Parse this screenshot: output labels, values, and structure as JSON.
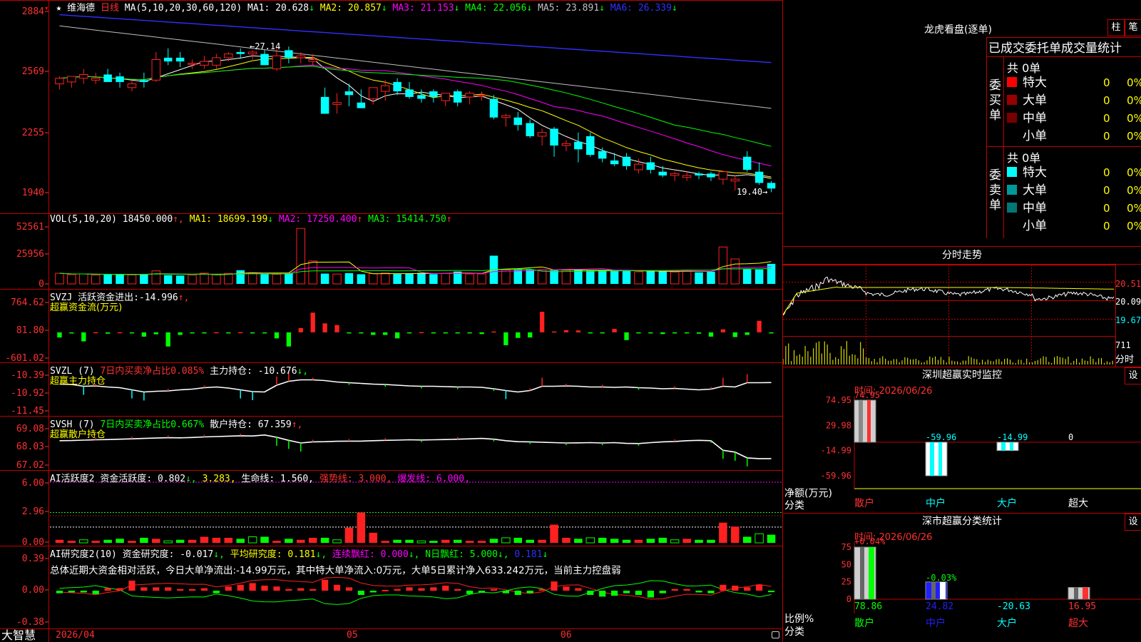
{
  "colors": {
    "up": "#ff2020",
    "down": "#00ffff",
    "ma1": "#ffffff",
    "ma2": "#ffff00",
    "ma3": "#ff00ff",
    "ma4": "#00ff00",
    "ma5": "#c0c0c0",
    "ma6": "#3030ff",
    "grid": "#c00000",
    "green": "#00ff00",
    "magenta": "#ff00ff",
    "yellow": "#ffff00",
    "cyan": "#00ffff"
  },
  "stock": {
    "name": "维海德",
    "period": "日线",
    "star": "★"
  },
  "main_panel": {
    "ma_label": "MA(5,10,20,30,60,120)",
    "ma": [
      {
        "label": "MA1:",
        "value": "20.628",
        "arrow": "↓"
      },
      {
        "label": "MA2:",
        "value": "20.857",
        "arrow": "↓"
      },
      {
        "label": "MA3:",
        "value": "21.153",
        "arrow": "↓"
      },
      {
        "label": "MA4:",
        "value": "22.056",
        "arrow": "↓"
      },
      {
        "label": "MA5:",
        "value": "23.891",
        "arrow": "↓"
      },
      {
        "label": "MA6:",
        "value": "26.339",
        "arrow": "↓"
      }
    ],
    "y_ticks": [
      "2884",
      "2569",
      "2255",
      "1940"
    ],
    "high_note": "27.14",
    "low_note": "19.40→"
  },
  "vol_panel": {
    "label": "VOL(5,10,20)",
    "value": "18450.000",
    "arrow": "↑",
    "ma": [
      {
        "label": "MA1:",
        "value": "18699.199",
        "arrow": "↓"
      },
      {
        "label": "MA2:",
        "value": "17250.400",
        "arrow": "↑"
      },
      {
        "label": "MA3:",
        "value": "15414.750",
        "arrow": "↑"
      }
    ],
    "y_ticks": [
      "52561",
      "25956",
      "0"
    ]
  },
  "svzj_panel": {
    "label": "SVZJ",
    "text": "活跃资金进出:",
    "value": "-14.996",
    "arrow": "↑",
    "subtitle": "超赢资金流(万元)",
    "y_ticks": [
      "764.62",
      "81.80",
      "-601.02"
    ]
  },
  "svzl_panel": {
    "label": "SVZL (7)",
    "note": "7日内买卖净占比0.085%",
    "text": "主力持仓:",
    "value": "-10.676",
    "arrow": "↓,",
    "subtitle": "超赢主力持仓",
    "y_ticks": [
      "-10.39",
      "-10.92",
      "-11.45"
    ]
  },
  "svsh_panel": {
    "label": "SVSH (7)",
    "note": "7日内买卖净占比0.667%",
    "text": "散户持仓:",
    "value": "67.359",
    "arrow": "↑,",
    "subtitle": "超赢散户持仓",
    "y_ticks": [
      "69.08",
      "68.03",
      "67.02"
    ]
  },
  "ai1_panel": {
    "label": "AI活跃度2",
    "t1": "资金活跃度:",
    "v1": "0.802",
    "a1": "↓,",
    "v2": "3.283,",
    "t3": "生命线:",
    "v3": "1.560,",
    "t4": "强势线:",
    "v4": "3.000,",
    "t5": "爆发线:",
    "v5": "6.000,",
    "y_ticks": [
      "6.00",
      "2.96",
      "0.00"
    ]
  },
  "ai2_panel": {
    "label": "AI研究度2(10)",
    "t1": "资金研究度:",
    "v1": "-0.017",
    "a1": "↓,",
    "t2": "平均研究度:",
    "v2": "0.181",
    "a2": "↓,",
    "t3": "连续飘红:",
    "v3": "0.000",
    "a3": "↓,",
    "t4": "N日飘红:",
    "v4": "5.000",
    "a4": "↓,",
    "v5": "0.181",
    "a5": "↓",
    "summary": "总体近期大资金相对活跃，今日大单净流出:-14.99万元，其中特大单净流入:0万元，大单5日累计净入633.242万元，当前主力控盘弱",
    "y_ticks": [
      "0.39",
      "0.00",
      "-0.38"
    ]
  },
  "bottom": {
    "brand": "大智慧",
    "dates": [
      "2026/04",
      "05",
      "06"
    ]
  },
  "lhb": {
    "title": "龙虎看盘(逐单)",
    "btn_zhu": "柱",
    "btn_bi": "笔",
    "heading": "已成交委托单成交量统计",
    "buy": {
      "side": "委买单",
      "total": "共 0单",
      "rows": [
        {
          "name": "特大",
          "count": "0",
          "pct": "0%",
          "color": "#ff0000"
        },
        {
          "name": "大单",
          "count": "0",
          "pct": "0%",
          "color": "#990000"
        },
        {
          "name": "中单",
          "count": "0",
          "pct": "0%",
          "color": "#770000"
        },
        {
          "name": "小单",
          "count": "0",
          "pct": "0%",
          "color": "#000000"
        }
      ]
    },
    "sell": {
      "side": "委卖单",
      "total": "共 0单",
      "rows": [
        {
          "name": "特大",
          "count": "0",
          "pct": "0%",
          "color": "#00ffff"
        },
        {
          "name": "大单",
          "count": "0",
          "pct": "0%",
          "color": "#009999"
        },
        {
          "name": "中单",
          "count": "0",
          "pct": "0%",
          "color": "#007777"
        },
        {
          "name": "小单",
          "count": "0",
          "pct": "0%",
          "color": "#000000"
        }
      ]
    }
  },
  "intraday": {
    "title": "分时走势",
    "prices": [
      "20.51",
      "20.09",
      "19.67"
    ],
    "vol": "711",
    "vol_label": "分时"
  },
  "sz_monitor": {
    "title": "深圳超赢实时监控",
    "btn": "设",
    "date": "时间: 2026/06/26",
    "y_ticks": [
      "74.95",
      "29.98",
      "-14.99",
      "-59.96"
    ],
    "axis_label": "净额(万元)",
    "axis_label2": "分类",
    "bars": [
      {
        "name": "散户",
        "value": 74.95,
        "label": "74.95"
      },
      {
        "name": "中户",
        "value": -59.96,
        "label": "-59.96"
      },
      {
        "name": "大户",
        "value": -14.99,
        "label": "-14.99"
      },
      {
        "name": "超大",
        "value": 0,
        "label": "0"
      }
    ]
  },
  "sz_class": {
    "title": "深市超赢分类统计",
    "btn": "设",
    "date": "时间: 2026/06/26",
    "y_ticks": [
      "75",
      "50",
      "25",
      "0"
    ],
    "axis_label": "比例%",
    "axis_label2": "分类",
    "top_labels": [
      "+0.04%",
      "-0.03%"
    ],
    "bars": [
      {
        "name": "散户",
        "value": 78.86,
        "label": "78.86"
      },
      {
        "name": "中户",
        "value": 24.82,
        "label": "24.82"
      },
      {
        "name": "大户",
        "value": -20.63,
        "label": "-20.63"
      },
      {
        "name": "超大",
        "value": 16.95,
        "label": "16.95"
      }
    ]
  },
  "chart_data": [
    {
      "type": "candlestick",
      "title": "维海德 日线",
      "ylim": [
        19.0,
        29.0
      ],
      "x": [
        "04-01",
        "04-02",
        "04-03",
        "04-06",
        "04-07",
        "04-08",
        "04-09",
        "04-10",
        "04-13",
        "04-14",
        "04-15",
        "04-16",
        "04-17",
        "04-20",
        "04-21",
        "04-22",
        "04-23",
        "04-24",
        "04-27",
        "04-28",
        "04-29",
        "04-30",
        "05-06",
        "05-07",
        "05-08",
        "05-11",
        "05-12",
        "05-13",
        "05-14",
        "05-15",
        "05-18",
        "05-19",
        "05-20",
        "05-21",
        "05-22",
        "05-25",
        "05-26",
        "05-27",
        "05-28",
        "05-29",
        "06-01",
        "06-02",
        "06-03",
        "06-04",
        "06-05",
        "06-08",
        "06-09",
        "06-10",
        "06-11",
        "06-12",
        "06-15",
        "06-16",
        "06-17",
        "06-18",
        "06-19",
        "06-22",
        "06-23",
        "06-24",
        "06-25",
        "06-26"
      ],
      "open": [
        25.2,
        25.3,
        25.5,
        25.4,
        25.7,
        25.6,
        25.0,
        25.4,
        25.4,
        26.6,
        26.6,
        26.3,
        26.2,
        26.2,
        26.6,
        26.9,
        26.8,
        26.8,
        26.0,
        27.0,
        26.6,
        26.4,
        24.5,
        24.1,
        24.8,
        24.2,
        24.4,
        24.8,
        25.3,
        24.9,
        24.6,
        24.8,
        24.3,
        24.8,
        24.5,
        24.6,
        24.4,
        23.4,
        23.4,
        23.1,
        22.4,
        22.8,
        21.9,
        22.1,
        22.4,
        21.6,
        21.1,
        21.3,
        20.6,
        21.0,
        20.5,
        20.3,
        20.2,
        20.4,
        20.4,
        20.1,
        20.0,
        21.3,
        20.5,
        19.9
      ],
      "high": [
        25.6,
        25.6,
        26.0,
        25.8,
        26.0,
        25.8,
        25.4,
        25.8,
        26.9,
        27.1,
        26.9,
        26.5,
        26.7,
        26.8,
        26.9,
        27.1,
        27.0,
        27.0,
        27.14,
        27.2,
        26.9,
        26.8,
        25.0,
        24.7,
        25.2,
        24.9,
        25.0,
        25.4,
        25.5,
        25.3,
        24.9,
        24.9,
        24.7,
        24.9,
        24.8,
        24.8,
        24.6,
        23.6,
        23.7,
        23.3,
        22.8,
        22.9,
        22.2,
        22.6,
        22.6,
        21.8,
        21.5,
        21.5,
        21.2,
        21.3,
        20.8,
        20.5,
        20.5,
        20.5,
        20.5,
        20.5,
        20.3,
        21.6,
        21.0,
        20.0
      ],
      "low": [
        24.9,
        25.0,
        25.2,
        25.2,
        25.4,
        25.0,
        24.8,
        25.0,
        25.3,
        26.2,
        26.1,
        26.0,
        26.0,
        26.0,
        26.4,
        26.6,
        26.5,
        26.3,
        25.9,
        26.3,
        26.3,
        26.2,
        23.6,
        23.6,
        24.0,
        23.9,
        24.1,
        24.3,
        24.6,
        24.4,
        24.2,
        24.2,
        24.0,
        24.0,
        24.1,
        24.3,
        23.3,
        22.9,
        22.7,
        22.3,
        21.9,
        21.3,
        21.6,
        21.0,
        21.3,
        21.0,
        20.8,
        20.6,
        20.4,
        20.4,
        20.2,
        20.0,
        20.0,
        20.1,
        20.0,
        19.8,
        19.5,
        20.5,
        19.8,
        19.4
      ],
      "close": [
        25.5,
        25.6,
        25.7,
        25.5,
        25.3,
        25.3,
        25.2,
        25.3,
        26.5,
        26.4,
        26.4,
        26.3,
        26.4,
        26.6,
        26.8,
        26.8,
        26.9,
        26.2,
        26.7,
        26.6,
        26.7,
        26.5,
        23.6,
        24.2,
        24.6,
        23.9,
        25.0,
        25.1,
        24.8,
        24.5,
        24.4,
        24.5,
        24.7,
        24.2,
        24.7,
        24.6,
        23.4,
        23.5,
        23.0,
        22.4,
        22.6,
        21.9,
        22.0,
        21.7,
        21.4,
        21.2,
        20.9,
        20.8,
        20.9,
        20.6,
        20.3,
        20.4,
        20.3,
        20.3,
        20.2,
        20.5,
        20.1,
        20.6,
        19.9,
        19.6
      ]
    },
    {
      "type": "bar",
      "title": "VOL(5,10,20)",
      "ylim": [
        0,
        52561
      ],
      "values": [
        9800,
        8600,
        9200,
        8100,
        8700,
        8900,
        8300,
        9000,
        12000,
        8100,
        7700,
        8000,
        9900,
        8600,
        9700,
        12600,
        10300,
        9000,
        8800,
        9800,
        51100,
        21100,
        9500,
        9100,
        9900,
        8900,
        9500,
        10000,
        9100,
        9800,
        10200,
        9000,
        9700,
        11400,
        9200,
        9200,
        26000,
        12900,
        13000,
        13200,
        13000,
        12500,
        12600,
        13100,
        12300,
        12500,
        12200,
        11800,
        11200,
        11800,
        11500,
        11000,
        12700,
        10600,
        11300,
        34000,
        23000,
        13600,
        13300,
        18450
      ]
    },
    {
      "type": "bar",
      "title": "SVZJ",
      "ylim": [
        -601.02,
        764.62
      ],
      "values": [
        -120,
        -3,
        -210,
        4,
        -30,
        2,
        -18,
        -100,
        -45,
        -330,
        -60,
        -20,
        -4,
        3,
        -4,
        5,
        -10,
        -5,
        -140,
        -330,
        100,
        460,
        210,
        170,
        -8,
        -6,
        -60,
        -60,
        -140,
        -5,
        5,
        -10,
        -5,
        -10,
        -5,
        -40,
        20,
        -300,
        -130,
        -120,
        480,
        20,
        50,
        45,
        -4,
        -8,
        80,
        -180,
        -10,
        -8,
        -40,
        -20,
        -10,
        -30,
        -100,
        70,
        -110,
        -60,
        270,
        -15
      ]
    },
    {
      "type": "line",
      "title": "SVZL (7)",
      "ylim": [
        -11.45,
        -10.39
      ],
      "values": [
        -10.72,
        -10.73,
        -10.78,
        -10.77,
        -10.8,
        -10.82,
        -10.88,
        -10.94,
        -10.92,
        -10.91,
        -10.88,
        -10.86,
        -10.82,
        -10.8,
        -10.83,
        -10.88,
        -10.93,
        -10.94,
        -10.75,
        -10.64,
        -10.6,
        -10.6,
        -10.62,
        -10.66,
        -10.68,
        -10.7,
        -10.72,
        -10.73,
        -10.75,
        -10.77,
        -10.78,
        -10.78,
        -10.79,
        -10.8,
        -10.8,
        -10.81,
        -10.85,
        -10.9,
        -10.94,
        -10.9,
        -10.78,
        -10.78,
        -10.77,
        -10.78,
        -10.8,
        -10.8,
        -10.81,
        -10.8,
        -10.82,
        -10.83,
        -10.85,
        -10.84,
        -10.86,
        -10.88,
        -10.86,
        -10.78,
        -10.8,
        -10.68,
        -10.68,
        -10.676
      ]
    },
    {
      "type": "line",
      "title": "SVSH (7)",
      "ylim": [
        67.02,
        69.08
      ],
      "values": [
        68.3,
        68.31,
        68.33,
        68.35,
        68.36,
        68.38,
        68.4,
        68.42,
        68.44,
        68.46,
        68.45,
        68.47,
        68.5,
        68.52,
        68.54,
        68.56,
        68.55,
        68.6,
        68.48,
        68.32,
        68.18,
        68.24,
        68.25,
        68.27,
        68.28,
        68.28,
        68.3,
        68.32,
        68.33,
        68.35,
        68.34,
        68.35,
        68.36,
        68.38,
        68.4,
        68.42,
        68.38,
        68.3,
        68.25,
        68.24,
        68.22,
        68.2,
        68.18,
        68.19,
        68.2,
        68.18,
        68.2,
        68.16,
        68.15,
        68.2,
        68.24,
        68.26,
        68.3,
        68.32,
        68.3,
        67.8,
        67.7,
        67.4,
        67.36,
        67.359
      ]
    },
    {
      "type": "bar",
      "title": "AI活跃度2",
      "ylim": [
        0,
        6.0
      ],
      "values": [
        0.3,
        0.2,
        0.3,
        0.2,
        0.3,
        0.4,
        0.2,
        0.5,
        0.4,
        0.2,
        0.3,
        0.3,
        0.6,
        0.5,
        0.5,
        0.4,
        0.6,
        0.6,
        0.2,
        0.4,
        0.3,
        0.5,
        0.5,
        0.3,
        1.5,
        3.0,
        1.0,
        0.2,
        0.3,
        0.3,
        0.2,
        0.2,
        0.3,
        0.3,
        0.2,
        0.2,
        0.4,
        0.5,
        0.5,
        0.3,
        0.3,
        1.8,
        0.5,
        0.4,
        0.5,
        0.5,
        0.4,
        0.3,
        0.3,
        0.4,
        0.5,
        0.3,
        0.4,
        0.3,
        0.3,
        2.0,
        1.6,
        0.6,
        0.9,
        0.802
      ]
    },
    {
      "type": "bar",
      "title": "AI研究度2(10)",
      "ylim": [
        -0.38,
        0.39
      ],
      "values": [
        -0.03,
        -0.02,
        -0.02,
        -0.04,
        0.03,
        0.03,
        0.12,
        0.04,
        0.04,
        0.04,
        0.02,
        0.02,
        0.03,
        -0.03,
        0.05,
        0.07,
        0.09,
        0.06,
        0.05,
        0.02,
        0.03,
        0.02,
        0.13,
        0.07,
        0.04,
        -0.05,
        -0.02,
        0.01,
        0.02,
        0.04,
        0.03,
        0.04,
        0.06,
        0.02,
        -0.04,
        -0.02,
        0.02,
        -0.03,
        -0.05,
        -0.03,
        0.02,
        0.11,
        0.05,
        0.03,
        -0.05,
        -0.07,
        -0.06,
        -0.03,
        -0.05,
        -0.08,
        -0.03,
        0.02,
        0.02,
        -0.02,
        -0.03,
        0.07,
        0.06,
        0.04,
        0.07,
        -0.017
      ]
    }
  ]
}
